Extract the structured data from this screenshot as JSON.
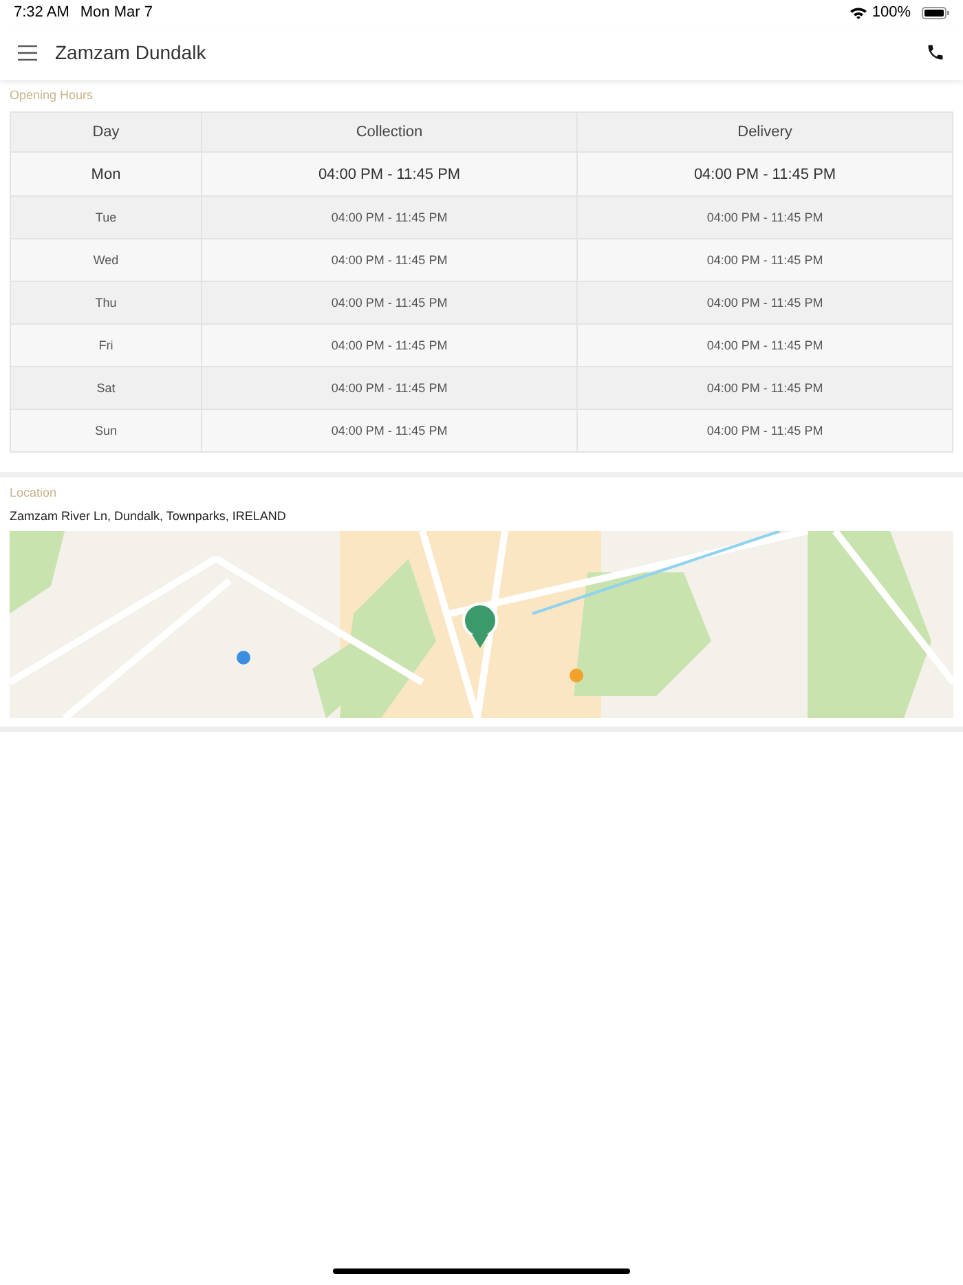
{
  "status_bar": {
    "time": "7:32 AM",
    "date": "Mon Mar 7",
    "battery": "100%"
  },
  "header": {
    "title": "Zamzam Dundalk"
  },
  "opening_hours": {
    "label": "Opening Hours",
    "columns": [
      "Day",
      "Collection",
      "Delivery"
    ],
    "rows": [
      {
        "day": "Mon",
        "collection": "04:00 PM - 11:45 PM",
        "delivery": "04:00 PM - 11:45 PM",
        "selected": true
      },
      {
        "day": "Tue",
        "collection": "04:00 PM - 11:45 PM",
        "delivery": "04:00 PM - 11:45 PM",
        "selected": false
      },
      {
        "day": "Wed",
        "collection": "04:00 PM - 11:45 PM",
        "delivery": "04:00 PM - 11:45 PM",
        "selected": false
      },
      {
        "day": "Thu",
        "collection": "04:00 PM - 11:45 PM",
        "delivery": "04:00 PM - 11:45 PM",
        "selected": false
      },
      {
        "day": "Fri",
        "collection": "04:00 PM - 11:45 PM",
        "delivery": "04:00 PM - 11:45 PM",
        "selected": false
      },
      {
        "day": "Sat",
        "collection": "04:00 PM - 11:45 PM",
        "delivery": "04:00 PM - 11:45 PM",
        "selected": false
      },
      {
        "day": "Sun",
        "collection": "04:00 PM - 11:45 PM",
        "delivery": "04:00 PM - 11:45 PM",
        "selected": false
      }
    ]
  },
  "location": {
    "label": "Location",
    "address": "Zamzam River Ln, Dundalk, Townparks, IRELAND"
  }
}
